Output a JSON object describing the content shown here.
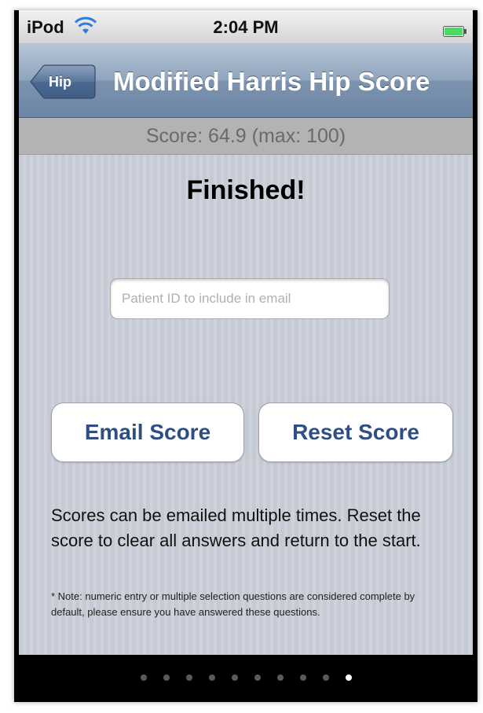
{
  "status_bar": {
    "carrier": "iPod",
    "time": "2:04 PM"
  },
  "nav": {
    "back_label": "Hip",
    "title": "Modified Harris Hip Score"
  },
  "score_bar": {
    "text": "Score: 64.9 (max: 100)"
  },
  "main": {
    "heading": "Finished!",
    "patient_input": {
      "placeholder": "Patient ID to include in email",
      "value": ""
    },
    "email_button": "Email Score",
    "reset_button": "Reset Score",
    "info": "Scores can be emailed multiple times. Reset the score to clear all answers and return to the start.",
    "note": "* Note: numeric entry or multiple selection questions are considered complete by default, please ensure you have answered these questions."
  },
  "page_control": {
    "page_count": 10,
    "current_page": 10
  },
  "colors": {
    "nav_bar": "#7c93af",
    "button_text": "#2f4f82",
    "battery": "#4cd964"
  },
  "icons": {
    "wifi": "wifi-icon",
    "battery": "battery-icon",
    "back": "back-arrow-icon"
  }
}
